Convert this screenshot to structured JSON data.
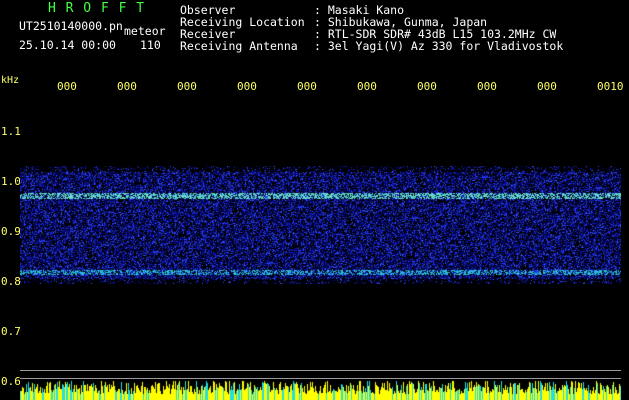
{
  "header": {
    "title": "H R O F F T",
    "filename": "UT2510140000.pn",
    "type_label": "meteor",
    "datetime": "25.10.14 00:00",
    "count": "110",
    "fields": [
      {
        "label": "Observer",
        "value": ": Masaki Kano"
      },
      {
        "label": "Receiving Location",
        "value": ": Shibukawa, Gunma, Japan"
      },
      {
        "label": "Receiver",
        "value": ": RTL-SDR SDR# 43dB L15 103.2MHz CW"
      },
      {
        "label": "Receiving Antenna",
        "value": ": 3el Yagi(V) Az 330 for Vladivostok"
      }
    ]
  },
  "axis": {
    "unit": "kHz",
    "y_labels": [
      "1.1",
      "1.0",
      "0.9",
      "0.8",
      "0.7",
      "0.6"
    ],
    "time_labels": [
      "000",
      "000",
      "000",
      "000",
      "000",
      "000",
      "000",
      "000",
      "000",
      "0010"
    ]
  },
  "colors": {
    "background": "#000000",
    "header_text": "#ffffff",
    "title_green": "#44ff44",
    "axis_yellow": "#ffff66",
    "noise_blue": "#1a2aff",
    "echo_cyan": "#66ffcc"
  }
}
